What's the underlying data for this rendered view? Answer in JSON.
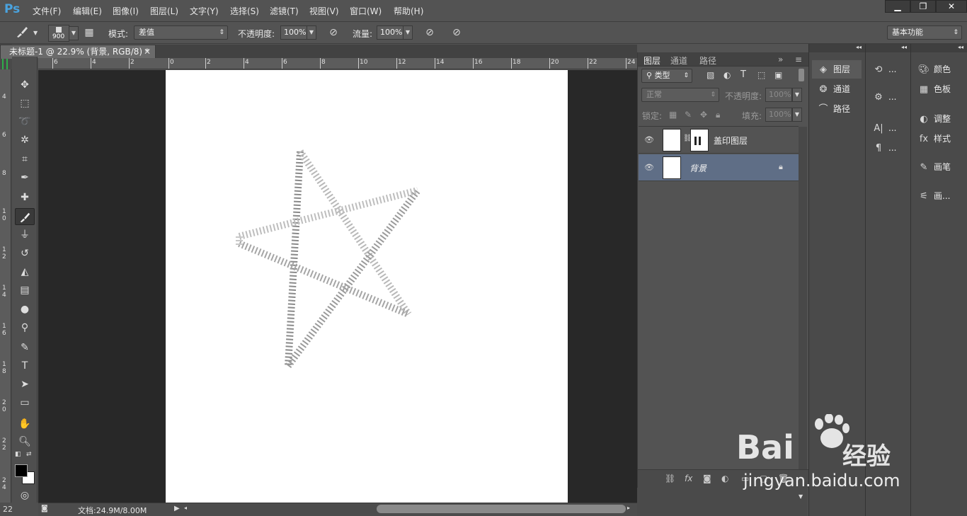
{
  "app": {
    "logo": "Ps"
  },
  "menu": [
    "文件(F)",
    "编辑(E)",
    "图像(I)",
    "图层(L)",
    "文字(Y)",
    "选择(S)",
    "滤镜(T)",
    "视图(V)",
    "窗口(W)",
    "帮助(H)"
  ],
  "window_controls": {
    "minimize": "▁",
    "restore": "❐",
    "close": "✕"
  },
  "options": {
    "brush_size": "900",
    "mode_label": "模式:",
    "mode_value": "差值",
    "opacity_label": "不透明度:",
    "opacity_value": "100%",
    "flow_label": "流量:",
    "flow_value": "100%",
    "workspace": "基本功能"
  },
  "document": {
    "tab_title": "未标题-1 @ 22.9% (背景, RGB/8) *",
    "close": "✕",
    "status_size": "文档:24.9M/8.00M",
    "zoom_corner": "22"
  },
  "rulers": {
    "h_ticks": [
      "6",
      "4",
      "2",
      "0",
      "2",
      "4",
      "6",
      "8",
      "10",
      "12",
      "14",
      "16",
      "18",
      "20",
      "22",
      "24"
    ],
    "v_ticks": [
      "4",
      "6",
      "8",
      "1 0",
      "1 2",
      "1 4",
      "1 6",
      "1 8",
      "2 0",
      "2 2",
      "2 4"
    ]
  },
  "layers_panel": {
    "tabs": [
      "图层",
      "通道",
      "路径"
    ],
    "filter_kind": "类型",
    "blend_mode": "正常",
    "opacity_label": "不透明度:",
    "opacity_value": "100%",
    "lock_label": "锁定:",
    "fill_label": "填充:",
    "fill_value": "100%",
    "layers": [
      {
        "name": "盖印图层",
        "visible": true,
        "selected": false,
        "locked": false
      },
      {
        "name": "背景",
        "visible": true,
        "selected": true,
        "locked": true
      }
    ]
  },
  "dock1": {
    "items": [
      "图层",
      "通道",
      "路径"
    ]
  },
  "dock2": {
    "items": [
      "...",
      "...",
      "...",
      "..."
    ]
  },
  "dock3": {
    "items": [
      "颜色",
      "色板",
      "调整",
      "样式",
      "画笔",
      "画..."
    ]
  },
  "watermark": {
    "brand": "Bai",
    "brand_cn": "经验",
    "url": "jingyan.baidu.com"
  },
  "colors": {
    "selected_layer": "#5f6e86",
    "canvas": "#ffffff",
    "workspace": "#282828",
    "ps_blue": "#4aa3df"
  }
}
